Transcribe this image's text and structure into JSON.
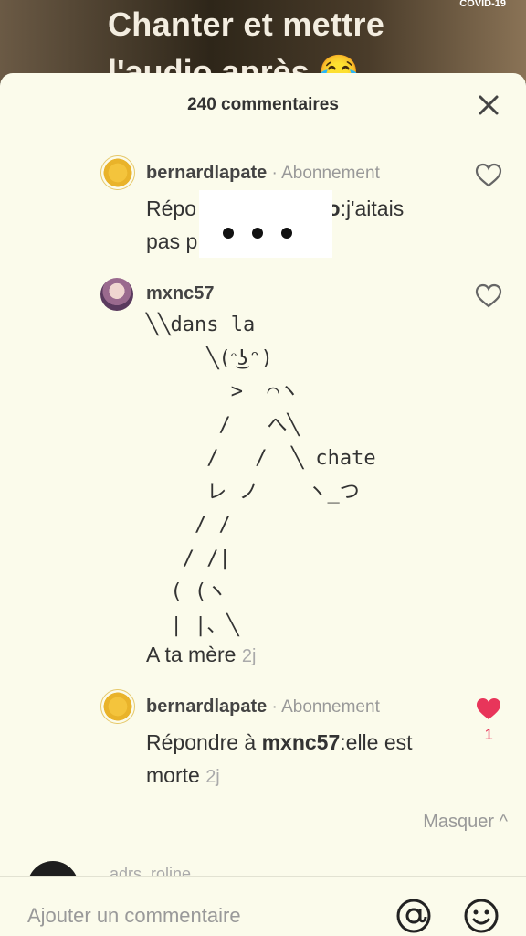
{
  "video": {
    "title_line1": "Chanter et mettre",
    "title_line2": "l'audio après 😂",
    "badge": "COVID-19"
  },
  "sheet": {
    "count_label": "240 commentaires",
    "close_icon": "close-icon"
  },
  "comments": [
    {
      "username": "bernardlapate",
      "subscription": " · Abonnement",
      "body_prefix": "Répo",
      "body_mention": "ello",
      "body_text": ":j'aitais",
      "body_line2": "pas p",
      "liked": false
    },
    {
      "username": "mxnc57",
      "ascii_art": "╲╲dans la\n     ╲(ᵔ͜ʖᵔ)\n       >  ⌒ヽ\n      /   へ╲\n     /   /  ╲ chate\n     レ ノ    ヽ_つ\n    / /\n   / /|\n  ( (ヽ\n  | |、╲",
      "body": "A ta mère",
      "time": "2j",
      "liked": false
    },
    {
      "username": "bernardlapate",
      "subscription": " · Abonnement",
      "reply_prefix": "Répondre à ",
      "reply_mention": "mxnc57",
      "reply_text": ":elle est",
      "reply_line2": "morte",
      "time": "2j",
      "like_count": "1",
      "liked": true,
      "like_color": "#e8355a"
    }
  ],
  "masquer_label": "Masquer ^",
  "next_comment_name": "adrs_roline",
  "input": {
    "placeholder": "Ajouter un commentaire",
    "at_icon": "at-icon",
    "emoji_icon": "emoji-icon"
  }
}
